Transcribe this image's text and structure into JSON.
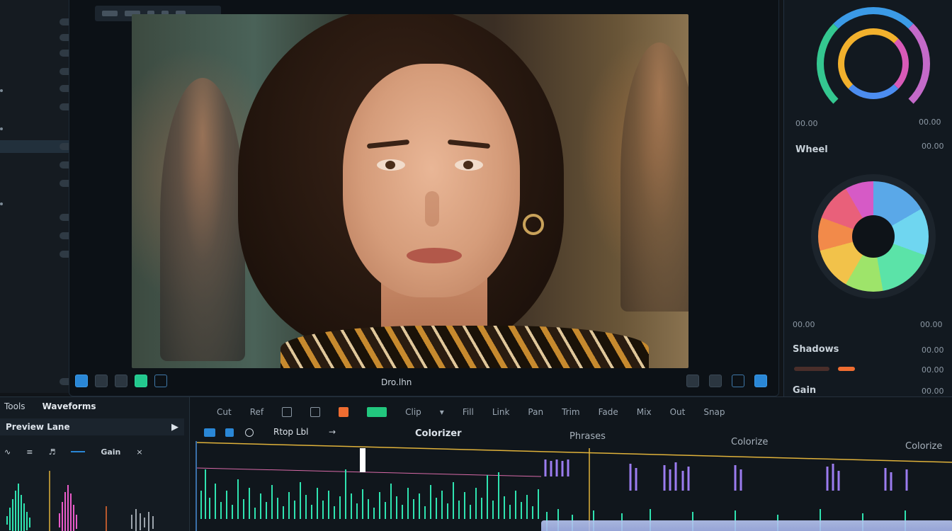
{
  "left_panel": {
    "rows": [
      "",
      "",
      "",
      "",
      "",
      "",
      "",
      "",
      "",
      "",
      "",
      "",
      ""
    ]
  },
  "viewer": {
    "bottom_label": "Dro.lhn"
  },
  "right_panel": {
    "scope_caption_left": "00.00",
    "scope_caption_right": "00.00",
    "wheel_heading": "Wheel",
    "wheel_value": "00.00",
    "val_row1_left": "00.00",
    "val_row1_right": "00.00",
    "section_heading": "Shadows",
    "section_value": "00.00",
    "sub_value": "00.00",
    "bottom_heading": "Gain",
    "bottom_value": "00.00"
  },
  "editor": {
    "panel_tab_1": "Tools",
    "panel_tab_2": "Waveforms",
    "section_title": "Preview Lane",
    "ctrl_label": "Gain",
    "track_label": "Rtop Lbl",
    "timeline_label_1": "Colorizer",
    "timeline_label_2": "Phrases",
    "timeline_label_3": "Colorize",
    "timeline_label_4": "Colorize",
    "toolbar_items": [
      "Cut",
      "Ref",
      "Clip",
      "Fill",
      "Link",
      "Pan",
      "Trim",
      "Fade",
      "Mix",
      "Out",
      "Snap"
    ]
  },
  "colors": {
    "accent_blue": "#2a87d6",
    "accent_green": "#22c77e",
    "accent_orange": "#ef6d31",
    "waveform": "#2fe3b0",
    "waveform_alt": "#9b7cf0",
    "playhead": "#e0b23a"
  }
}
